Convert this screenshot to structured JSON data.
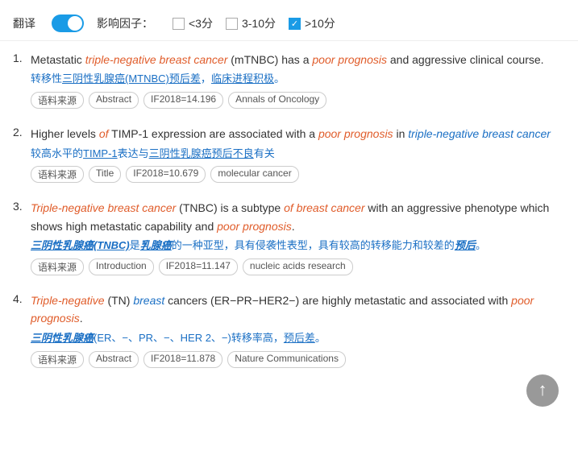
{
  "toolbar": {
    "translate_label": "翻译",
    "influence_factor_label": "影响因子：",
    "filters": [
      {
        "id": "lt3",
        "label": "<3分",
        "checked": false
      },
      {
        "id": "3to10",
        "label": "3-10分",
        "checked": false
      },
      {
        "id": "gt10",
        "label": ">10分",
        "checked": true
      }
    ]
  },
  "results": [
    {
      "number": "1.",
      "en_parts": [
        {
          "text": "Metastatic ",
          "style": "normal"
        },
        {
          "text": "triple-negative breast cancer",
          "style": "italic-red"
        },
        {
          "text": " (mTNBC) has a ",
          "style": "normal"
        },
        {
          "text": "poor prognosis",
          "style": "italic-red"
        },
        {
          "text": " and aggressive clinical course.",
          "style": "normal"
        }
      ],
      "zh_text": "转移性三阴性乳腺癌(MTNBC)预后差，临床进程积极。",
      "zh_underlined": [
        "三阴性乳腺癌(MTNBC)",
        "预后差",
        "临床进程积极"
      ],
      "tags": [
        "语料来源",
        "Abstract",
        "IF2018=14.196",
        "Annals of Oncology"
      ]
    },
    {
      "number": "2.",
      "en_parts": [
        {
          "text": "Higher levels ",
          "style": "normal"
        },
        {
          "text": "of",
          "style": "italic-red"
        },
        {
          "text": " TIMP-1 expression are associated with a ",
          "style": "normal"
        },
        {
          "text": "poor prognosis",
          "style": "italic-red"
        },
        {
          "text": " in ",
          "style": "normal"
        },
        {
          "text": "triple-negative breast cancer",
          "style": "italic-blue"
        }
      ],
      "zh_text": "较高水平的TIMP-1表达与三阴性乳腺癌预后不良有关",
      "zh_underlined": [
        "TIMP-1",
        "三阴性乳腺癌",
        "预后不良"
      ],
      "tags": [
        "语料来源",
        "Title",
        "IF2018=10.679",
        "molecular cancer"
      ]
    },
    {
      "number": "3.",
      "en_parts": [
        {
          "text": "Triple-negative breast cancer",
          "style": "italic-red"
        },
        {
          "text": " (TNBC) is a subtype ",
          "style": "normal"
        },
        {
          "text": "of breast cancer",
          "style": "italic-red"
        },
        {
          "text": " with an aggressive phenotype which shows high metastatic capability and ",
          "style": "normal"
        },
        {
          "text": "poor prognosis",
          "style": "italic-red"
        },
        {
          "text": ".",
          "style": "normal"
        }
      ],
      "zh_text": "三阴性乳腺癌(TNBC)是乳腺癌的一种亚型，具有侵袭性表型，具有较高的转移能力和较差的预后。",
      "zh_underlined": [
        "三阴性乳腺癌(TNBC)",
        "乳腺癌",
        "预后"
      ],
      "tags": [
        "语料来源",
        "Introduction",
        "IF2018=11.147",
        "nucleic acids research"
      ]
    },
    {
      "number": "4.",
      "en_parts": [
        {
          "text": "Triple-negative",
          "style": "italic-red"
        },
        {
          "text": " (TN) ",
          "style": "normal"
        },
        {
          "text": "breast",
          "style": "italic-blue"
        },
        {
          "text": " cancers (ER−PR−HER2−) are highly metastatic and associated with ",
          "style": "normal"
        },
        {
          "text": "poor prognosis",
          "style": "italic-red"
        },
        {
          "text": ".",
          "style": "normal"
        }
      ],
      "zh_text": "三阴性乳腺癌(ER、−、PR、−、HER 2、−)转移率高，预后差。",
      "zh_underlined": [
        "三阴性乳腺癌",
        "预后差"
      ],
      "tags": [
        "语料来源",
        "Abstract",
        "IF2018=11.878",
        "Nature Communications"
      ]
    }
  ],
  "scroll_top_label": "↑"
}
